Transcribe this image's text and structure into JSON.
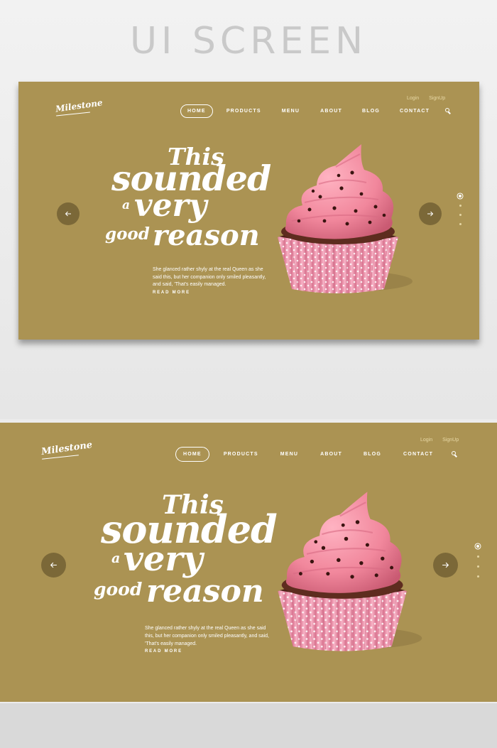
{
  "page": {
    "title": "UI SCREEN"
  },
  "brand": {
    "logo_text": "Milestone"
  },
  "auth": {
    "login": "Login",
    "signup": "SignUp"
  },
  "nav": {
    "items": [
      {
        "label": "HOME",
        "active": true
      },
      {
        "label": "PRODUCTS",
        "active": false
      },
      {
        "label": "MENU",
        "active": false
      },
      {
        "label": "ABOUT",
        "active": false
      },
      {
        "label": "BLOG",
        "active": false
      },
      {
        "label": "CONTACT",
        "active": false
      }
    ],
    "search_icon": "search-icon"
  },
  "hero": {
    "headline": {
      "line1": "This",
      "line2": "sounded",
      "line3a": "a",
      "line3b": "very",
      "line4a": "good",
      "line4b": "reason"
    },
    "body": "She glanced rather shyly at the real Queen as she said this, but her companion only smiled pleasantly, and said, 'That's easily managed.",
    "read_more": "READ MORE"
  },
  "slider": {
    "prev_icon": "arrow-left-icon",
    "next_icon": "arrow-right-icon",
    "slide_count": 4,
    "active_slide": 1
  },
  "colors": {
    "banner": "#ab9353",
    "button": "#7b6838",
    "frosting": "#f0879c",
    "liner": "#f39ab2",
    "cake": "#5a2a1e"
  }
}
